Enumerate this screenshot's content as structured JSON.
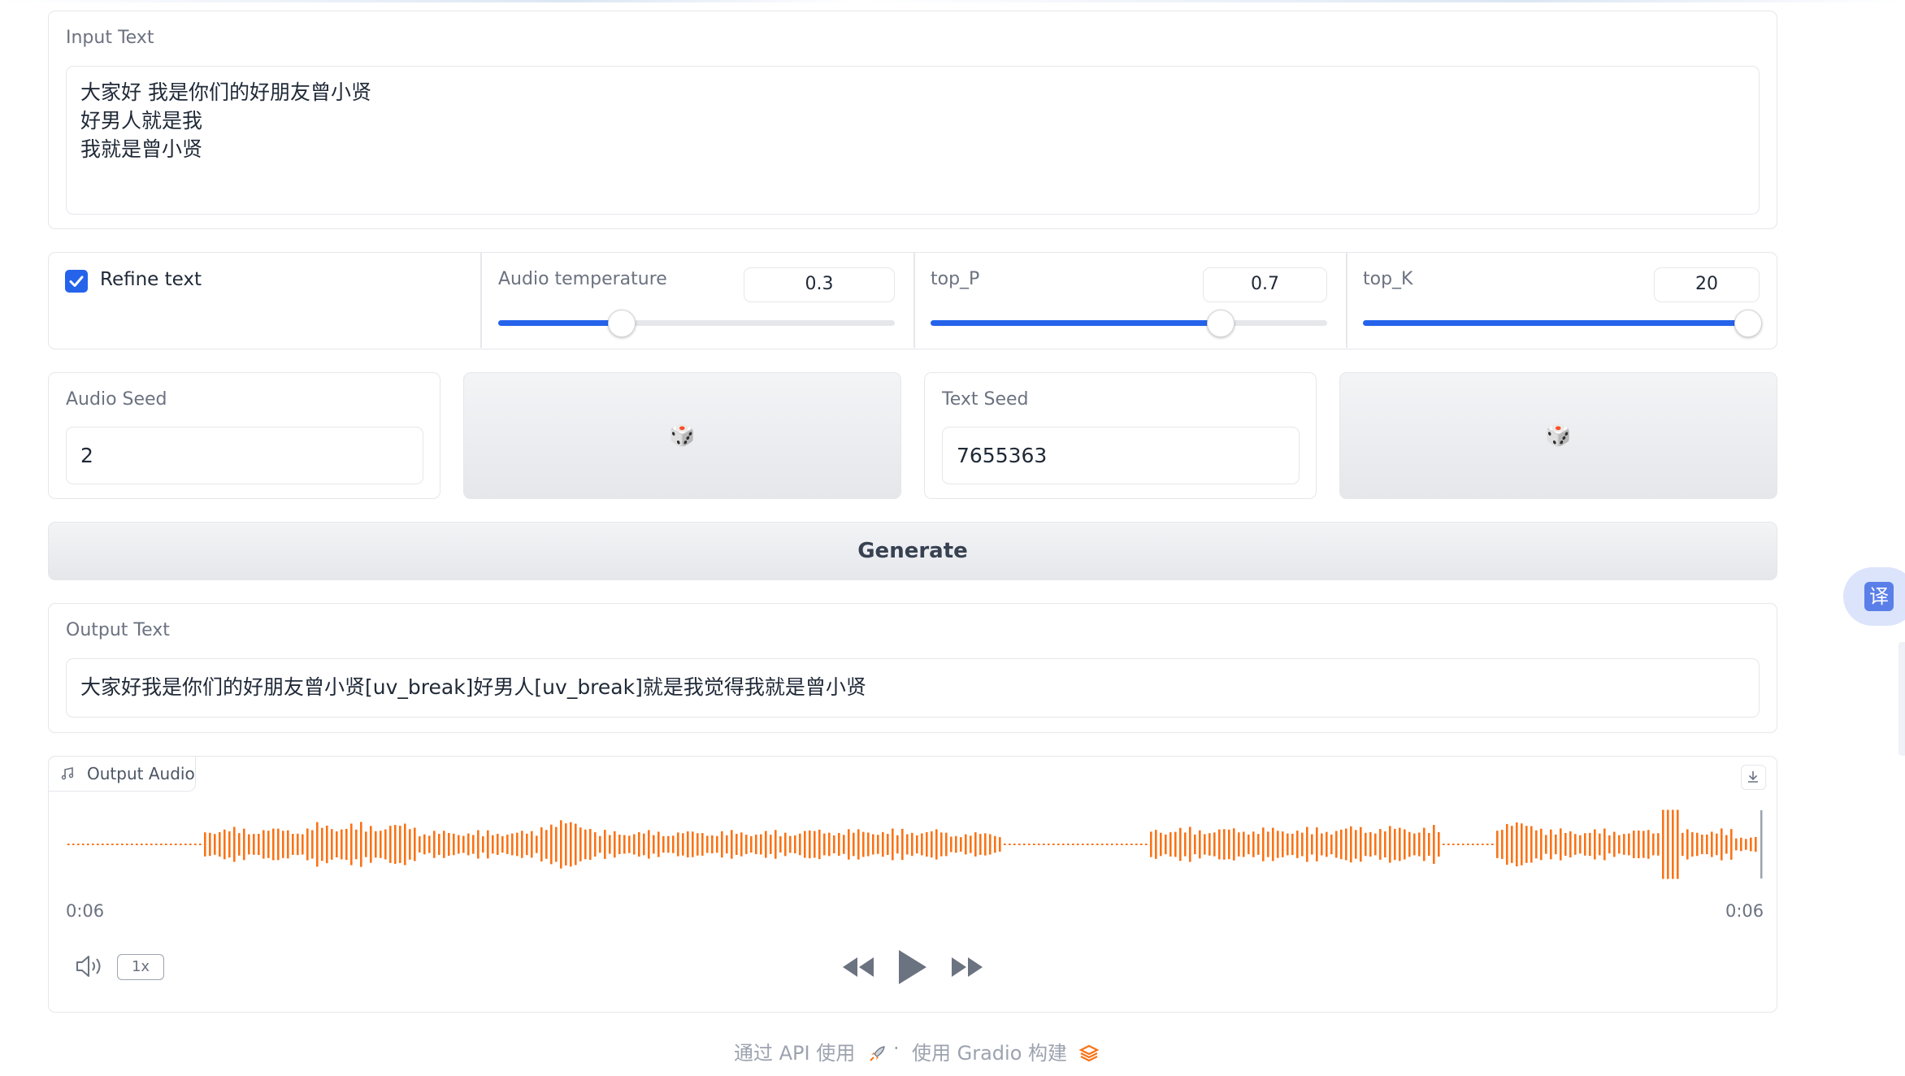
{
  "input": {
    "label": "Input Text",
    "value": "大家好 我是你们的好朋友曾小贤\n好男人就是我\n我就是曾小贤"
  },
  "params": {
    "refine_text": {
      "label": "Refine text",
      "checked": true
    },
    "audio_temperature": {
      "label": "Audio temperature",
      "value": "0.3",
      "fraction": 0.31
    },
    "top_p": {
      "label": "top_P",
      "value": "0.7",
      "fraction": 0.73
    },
    "top_k": {
      "label": "top_K",
      "value": "20",
      "fraction": 0.97
    }
  },
  "seeds": {
    "audio": {
      "label": "Audio Seed",
      "value": "2"
    },
    "text": {
      "label": "Text Seed",
      "value": "7655363"
    },
    "dice_icon": "🎲"
  },
  "generate": {
    "label": "Generate"
  },
  "output": {
    "label": "Output Text",
    "value": "大家好我是你们的好朋友曾小贤[uv_break]好男人[uv_break]就是我觉得我就是曾小贤"
  },
  "audio": {
    "label": "Output Audio",
    "time_current": "0:06",
    "time_total": "0:06",
    "speed": "1x",
    "waveform_color": "#f97316"
  },
  "footer": {
    "api_text": "通过 API 使用",
    "separator": "·",
    "built_text": "使用 Gradio 构建"
  },
  "translate_widget": {
    "label": "译"
  },
  "colors": {
    "accent": "#2563eb",
    "waveform": "#f97316"
  }
}
